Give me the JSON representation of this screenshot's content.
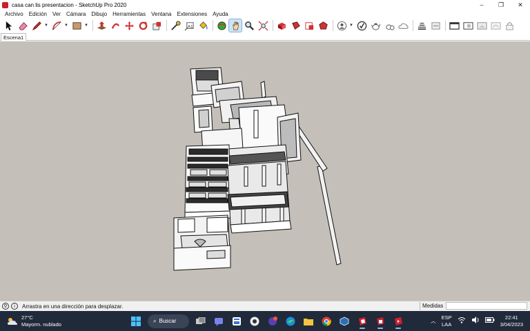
{
  "window": {
    "title": "casa can lis presentacion - SketchUp Pro 2020",
    "minimize": "–",
    "maximize": "❐",
    "close": "✕"
  },
  "menu": [
    "Archivo",
    "Edición",
    "Ver",
    "Cámara",
    "Dibujo",
    "Herramientas",
    "Ventana",
    "Extensiones",
    "Ayuda"
  ],
  "scene": {
    "tab": "Escena1"
  },
  "status": {
    "message": "Arrastra en una dirección para desplazar.",
    "measures_label": "Medidas",
    "measures_value": ""
  },
  "taskbar": {
    "temperature": "27°C",
    "weather": "Mayorm. nublado",
    "search_label": "Buscar",
    "language_top": "ESP",
    "language_bottom": "LAA",
    "time": "22:41",
    "date": "3/04/2023"
  }
}
